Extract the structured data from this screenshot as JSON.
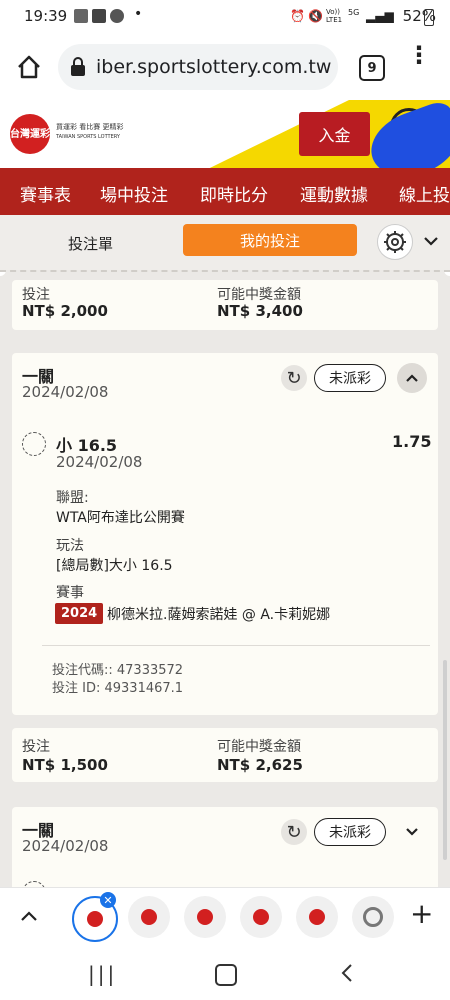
{
  "status_bar": {
    "time": "19:39",
    "battery": "52%",
    "volte": "Vo)) LTE1",
    "network": "5G"
  },
  "browser": {
    "url": "iber.sportslottery.com.tw",
    "tab_count": "9"
  },
  "header": {
    "logo_text": "台灣運彩",
    "logo_tagline_1": "買運彩 看比賽 更精彩",
    "logo_tagline_2": "TAIWAN SPORTS LOTTERY",
    "deposit_label": "入金"
  },
  "nav": {
    "items": [
      "賽事表",
      "場中投注",
      "即時比分",
      "運動數據",
      "線上投"
    ]
  },
  "tabs": {
    "bet_slip": "投注單",
    "my_bets": "我的投注"
  },
  "summary_top": {
    "stake_label": "投注",
    "stake_value": "NT$ 2,000",
    "payout_label": "可能中獎金額",
    "payout_value": "NT$ 3,400"
  },
  "bet_card_1": {
    "title": "一關",
    "date": "2024/02/08",
    "status": "未派彩",
    "selection": "小 16.5",
    "selection_date": "2024/02/08",
    "odds": "1.75",
    "league_label": "聯盟:",
    "league_value": "WTA阿布達比公開賽",
    "play_label": "玩法",
    "play_value": "[總局數]大小 16.5",
    "event_label": "賽事",
    "event_year": "2024",
    "event_value": "柳德米拉.薩姆索諾娃 @ A.卡莉妮娜",
    "bet_code": "投注代碼:: 47333572",
    "bet_id": "投注 ID: 49331467.1",
    "stake_label": "投注",
    "stake_value": "NT$ 1,500",
    "payout_label": "可能中獎金額",
    "payout_value": "NT$ 2,625"
  },
  "bet_card_2": {
    "title": "一關",
    "date": "2024/02/08",
    "status": "未派彩"
  },
  "icons": {
    "lock": "lock-icon",
    "home": "home-icon",
    "more": "more-vert-icon",
    "settings": "gear-icon",
    "refresh": "refresh-icon"
  },
  "colors": {
    "brand_red": "#b0231c",
    "accent_orange": "#f4821e",
    "yellow": "#f5d800"
  }
}
